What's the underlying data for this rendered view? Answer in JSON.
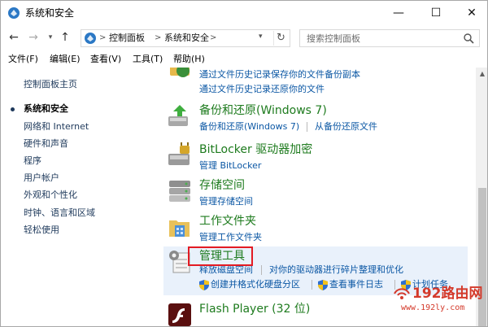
{
  "window": {
    "title": "系统和安全",
    "controls": {
      "minimize": "—",
      "maximize": "☐",
      "close": "✕"
    }
  },
  "address": {
    "crumbs": [
      "控制面板",
      "系统和安全"
    ],
    "separator": ">",
    "search_placeholder": "搜索控制面板"
  },
  "menubar": {
    "items": [
      "文件(F)",
      "编辑(E)",
      "查看(V)",
      "工具(T)",
      "帮助(H)"
    ]
  },
  "leftnav": {
    "home": "控制面板主页",
    "items": [
      {
        "label": "系统和安全",
        "current": true
      },
      {
        "label": "网络和 Internet"
      },
      {
        "label": "硬件和声音"
      },
      {
        "label": "程序"
      },
      {
        "label": "用户帐户"
      },
      {
        "label": "外观和个性化"
      },
      {
        "label": "时钟、语言和区域"
      },
      {
        "label": "轻松使用"
      }
    ]
  },
  "sections": {
    "file_history": {
      "tasks": [
        "通过文件历史记录保存你的文件备份副本",
        "通过文件历史记录还原你的文件"
      ]
    },
    "backup": {
      "title": "备份和还原(Windows 7)",
      "tasks": [
        "备份和还原(Windows 7)",
        "从备份还原文件"
      ]
    },
    "bitlocker": {
      "title": "BitLocker 驱动器加密",
      "tasks": [
        "管理 BitLocker"
      ]
    },
    "storage": {
      "title": "存储空间",
      "tasks": [
        "管理存储空间"
      ]
    },
    "work_folders": {
      "title": "工作文件夹",
      "tasks": [
        "管理工作文件夹"
      ]
    },
    "admin_tools": {
      "title": "管理工具",
      "tasks": [
        "释放磁盘空间",
        "对你的驱动器进行碎片整理和优化",
        "创建并格式化硬盘分区",
        "查看事件日志",
        "计划任务"
      ]
    },
    "flash": {
      "title": "Flash Player (32 位)"
    }
  },
  "watermark": {
    "main": "192路由网",
    "sub": "www.192ly.com"
  },
  "colors": {
    "section_title": "#1e7b1e",
    "task_link": "#0b57a4",
    "highlight_bg": "#e9f1fb",
    "red_box": "#e31b23"
  }
}
